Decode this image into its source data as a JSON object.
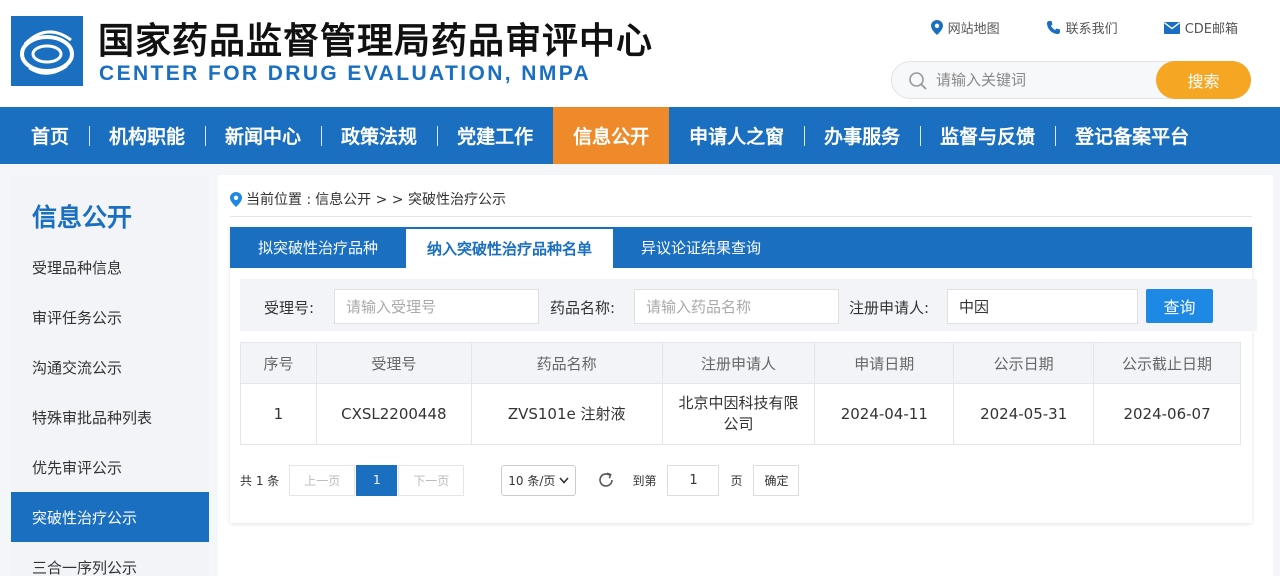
{
  "header": {
    "title_cn": "国家药品监督管理局药品审评中心",
    "title_en": "CENTER FOR DRUG EVALUATION, NMPA",
    "top_links": [
      {
        "icon": "location-pin-icon",
        "label": "网站地图"
      },
      {
        "icon": "phone-icon",
        "label": "联系我们"
      },
      {
        "icon": "mail-icon",
        "label": "CDE邮箱"
      }
    ],
    "search": {
      "placeholder": "请输入关键词",
      "button": "搜索"
    }
  },
  "nav": {
    "items": [
      "首页",
      "机构职能",
      "新闻中心",
      "政策法规",
      "党建工作",
      "信息公开",
      "申请人之窗",
      "办事服务",
      "监督与反馈",
      "登记备案平台"
    ],
    "active_index": 5
  },
  "sidebar": {
    "title": "信息公开",
    "items": [
      "受理品种信息",
      "审评任务公示",
      "沟通交流公示",
      "特殊审批品种列表",
      "优先审评公示",
      "突破性治疗公示",
      "三合一序列公示"
    ],
    "active_index": 5
  },
  "breadcrumb": {
    "prefix": "当前位置 :",
    "path": "信息公开 > > 突破性治疗公示"
  },
  "tabs": {
    "items": [
      "拟突破性治疗品种",
      "纳入突破性治疗品种名单",
      "异议论证结果查询"
    ],
    "active_index": 1
  },
  "filter": {
    "accept_no_label": "受理号:",
    "accept_no_placeholder": "请输入受理号",
    "drug_name_label": "药品名称:",
    "drug_name_placeholder": "请输入药品名称",
    "applicant_label": "注册申请人:",
    "applicant_value": "中因",
    "query_button": "查询"
  },
  "table": {
    "headers": [
      "序号",
      "受理号",
      "药品名称",
      "注册申请人",
      "申请日期",
      "公示日期",
      "公示截止日期"
    ],
    "rows": [
      [
        "1",
        "CXSL2200448",
        "ZVS101e 注射液",
        "北京中因科技有限公司",
        "2024-04-11",
        "2024-05-31",
        "2024-06-07"
      ]
    ]
  },
  "pager": {
    "total": "共 1 条",
    "prev": "上一页",
    "current": "1",
    "next": "下一页",
    "page_size": "10 条/页",
    "goto_label": "到第",
    "goto_value": "1",
    "unit": "页",
    "confirm": "确定"
  },
  "colors": {
    "brand_blue": "#1a6fc1",
    "nav_active_orange": "#ef8a2a",
    "search_button": "#f5a623"
  }
}
